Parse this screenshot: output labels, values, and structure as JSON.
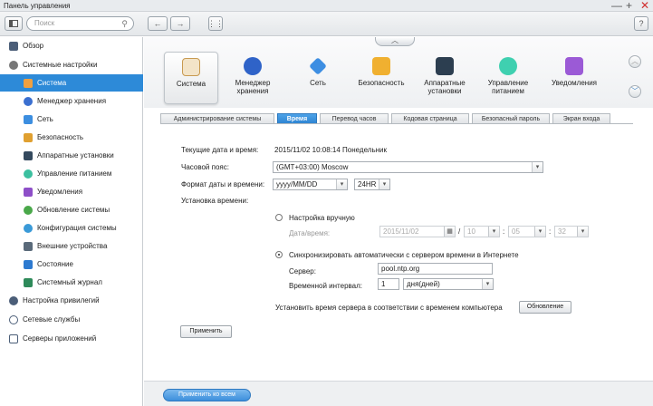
{
  "window": {
    "title": "Панель управления",
    "controls": [
      "—",
      "+",
      "✕"
    ]
  },
  "toolbar": {
    "search_placeholder": "Поиск",
    "back": "←",
    "forward": "→",
    "apps": "⋮⋮",
    "help": "?"
  },
  "sidebar": {
    "items": [
      {
        "label": "Обзор",
        "icon": "overview-icon",
        "level": 0
      },
      {
        "label": "Системные настройки",
        "icon": "settings-icon",
        "level": 0
      },
      {
        "label": "Система",
        "icon": "system-icon",
        "level": 1,
        "active": true
      },
      {
        "label": "Менеджер хранения",
        "icon": "storage-icon",
        "level": 1
      },
      {
        "label": "Сеть",
        "icon": "network-icon",
        "level": 1
      },
      {
        "label": "Безопасность",
        "icon": "lock-icon",
        "level": 1
      },
      {
        "label": "Аппаратные установки",
        "icon": "hardware-icon",
        "level": 1
      },
      {
        "label": "Управление питанием",
        "icon": "power-icon",
        "level": 1
      },
      {
        "label": "Уведомления",
        "icon": "notification-icon",
        "level": 1
      },
      {
        "label": "Обновление системы",
        "icon": "update-icon",
        "level": 1
      },
      {
        "label": "Конфигурация системы",
        "icon": "config-icon",
        "level": 1
      },
      {
        "label": "Внешние устройства",
        "icon": "external-device-icon",
        "level": 1
      },
      {
        "label": "Состояние",
        "icon": "status-icon",
        "level": 1
      },
      {
        "label": "Системный журнал",
        "icon": "log-icon",
        "level": 1
      },
      {
        "label": "Настройка привилегий",
        "icon": "user-icon",
        "level": 0
      },
      {
        "label": "Сетевые службы",
        "icon": "network-services-icon",
        "level": 0
      },
      {
        "label": "Серверы приложений",
        "icon": "app-server-icon",
        "level": 0
      }
    ]
  },
  "icon_bar": {
    "items": [
      {
        "label": "Система",
        "icon": "system-icon",
        "selected": true
      },
      {
        "label": "Менеджер хранения",
        "icon": "storage-icon"
      },
      {
        "label": "Сеть",
        "icon": "network-icon"
      },
      {
        "label": "Безопасность",
        "icon": "lock-icon"
      },
      {
        "label": "Аппаратные установки",
        "icon": "hardware-icon"
      },
      {
        "label": "Управление питанием",
        "icon": "power-icon"
      },
      {
        "label": "Уведомления",
        "icon": "notification-icon"
      }
    ]
  },
  "tabs": [
    {
      "label": "Администрирование системы"
    },
    {
      "label": "Время",
      "active": true
    },
    {
      "label": "Перевод часов"
    },
    {
      "label": "Кодовая страница"
    },
    {
      "label": "Безопасный пароль"
    },
    {
      "label": "Экран входа"
    }
  ],
  "form": {
    "current_label": "Текущие дата и время:",
    "current_value": "2015/11/02 10:08:14 Понедельник",
    "tz_label": "Часовой пояс:",
    "tz_value": "(GMT+03:00) Moscow",
    "format_label": "Формат даты и времени:",
    "date_format": "yyyy/MM/DD",
    "time_format": "24HR",
    "set_time_label": "Установка времени:",
    "manual_label": "Настройка вручную",
    "datetime_label": "Дата/время:",
    "manual_date": "2015/11/02",
    "hour": "10",
    "minute": "05",
    "second": "32",
    "colon": ":",
    "slash": "/",
    "sync_label": "Синхронизировать автоматически с сервером времени в Интернете",
    "server_label": "Сервер:",
    "server_value": "pool.ntp.org",
    "interval_label": "Временной интервал:",
    "interval_value": "1",
    "interval_unit": "дня(дней)",
    "sync_pc_label": "Установить время сервера в соответствии с временем компьютера",
    "update_button": "Обновление",
    "apply_button": "Применить"
  },
  "footer": {
    "apply_all": "Применить ко всем"
  },
  "colors": {
    "accent": "#2d8ad8",
    "active_tab": "#3a8fd6"
  }
}
